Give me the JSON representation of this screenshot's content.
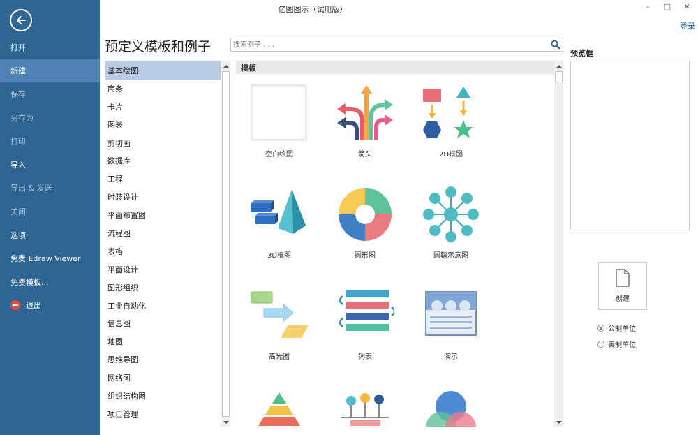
{
  "window": {
    "title": "亿图图示（试用版）",
    "controls": [
      "–",
      "□",
      "✕"
    ],
    "login": "登录"
  },
  "sidebar": {
    "items": [
      {
        "label": "打开",
        "state": "normal"
      },
      {
        "label": "新建",
        "state": "active"
      },
      {
        "label": "保存",
        "state": "disabled"
      },
      {
        "label": "另存为",
        "state": "disabled"
      },
      {
        "label": "打印",
        "state": "disabled"
      },
      {
        "label": "导入",
        "state": "normal"
      },
      {
        "label": "导出 & 发送",
        "state": "disabled"
      },
      {
        "label": "关闭",
        "state": "disabled"
      },
      {
        "label": "选项",
        "state": "normal"
      },
      {
        "label": "免费 Edraw Viewer",
        "state": "normal"
      },
      {
        "label": "免费模板...",
        "state": "normal"
      },
      {
        "label": "退出",
        "state": "normal"
      }
    ]
  },
  "main": {
    "heading": "预定义模板和例子",
    "search_placeholder": "搜索例子 . . .",
    "categories": [
      "基本绘图",
      "商务",
      "卡片",
      "图表",
      "剪切画",
      "数据库",
      "工程",
      "时装设计",
      "平面布置图",
      "流程图",
      "表格",
      "平面设计",
      "图形组织",
      "工业自动化",
      "信息图",
      "地图",
      "思维导图",
      "网络图",
      "组织结构图",
      "项目管理"
    ],
    "selected_category": "基本绘图",
    "templates_header": "模板",
    "templates": [
      {
        "label": "空白绘图",
        "icon": "blank-page-icon"
      },
      {
        "label": "箭头",
        "icon": "arrows-icon"
      },
      {
        "label": "2D框图",
        "icon": "2d-block-icon"
      },
      {
        "label": "3D框图",
        "icon": "3d-block-icon"
      },
      {
        "label": "圆形图",
        "icon": "circle-chart-icon"
      },
      {
        "label": "圆辐示意图",
        "icon": "spoke-diagram-icon"
      },
      {
        "label": "高光图",
        "icon": "highlight-icon"
      },
      {
        "label": "列表",
        "icon": "list-icon"
      },
      {
        "label": "演示",
        "icon": "presentation-icon"
      }
    ]
  },
  "preview": {
    "label": "预览框",
    "create_label": "创建",
    "units": [
      {
        "label": "公制单位",
        "checked": true
      },
      {
        "label": "美制单位",
        "checked": false
      }
    ]
  },
  "colors": {
    "sidebar": "#2f6593",
    "sidebar_active": "#4d82b3",
    "selected_category": "#b8cbe6"
  }
}
